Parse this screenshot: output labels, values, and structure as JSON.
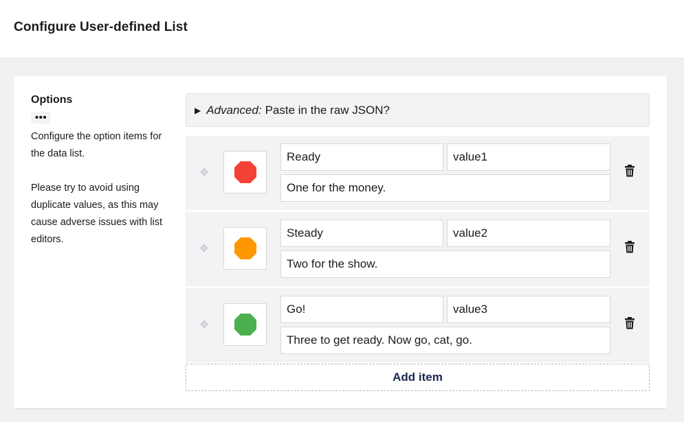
{
  "header": {
    "title": "Configure User-defined List"
  },
  "options": {
    "label": "Options",
    "more_label": "•••",
    "description_1": "Configure the option items for the data list.",
    "description_2": "Please try to avoid using duplicate values, as this may cause adverse issues with list editors."
  },
  "advanced": {
    "toggle": "▶",
    "emphasis": "Advanced:",
    "text": "Paste in the raw JSON?"
  },
  "items": [
    {
      "name": "Ready",
      "value": "value1",
      "description": "One for the money.",
      "color": "#f44336",
      "handle_icon": "drag-handle-icon",
      "delete_icon": "trash-icon"
    },
    {
      "name": "Steady",
      "value": "value2",
      "description": "Two for the show.",
      "color": "#ff9800",
      "handle_icon": "drag-handle-icon",
      "delete_icon": "trash-icon"
    },
    {
      "name": "Go!",
      "value": "value3",
      "description": "Three to get ready. Now go, cat, go.",
      "color": "#4caf50",
      "handle_icon": "drag-handle-icon",
      "delete_icon": "trash-icon"
    }
  ],
  "add_item_label": "Add item"
}
